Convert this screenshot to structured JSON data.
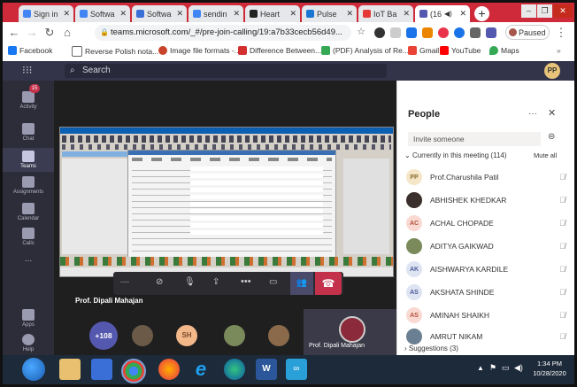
{
  "browser": {
    "tabs": [
      {
        "label": "Sign in",
        "color": "#4285f4"
      },
      {
        "label": "Softwa",
        "color": "#4285f4"
      },
      {
        "label": "Softwa",
        "color": "#3a6fd8"
      },
      {
        "label": "sendin",
        "color": "#4285f4"
      },
      {
        "label": "Heart",
        "color": "#222222"
      },
      {
        "label": "Pulse",
        "color": "#1976d2"
      },
      {
        "label": "IoT Ba",
        "color": "#e53935"
      },
      {
        "label": "(16",
        "color": "#5558af"
      }
    ],
    "new_tab": "+",
    "url": "teams.microsoft.com/_#/pre-join-calling/19:a7b33cecb56d49...",
    "paused_label": "Paused",
    "bookmarks": [
      "Facebook",
      "Reverse Polish nota...",
      "Image file formats -...",
      "Difference Between...",
      "(PDF) Analysis of Re...",
      "Gmail",
      "YouTube",
      "Maps"
    ],
    "bookmark_colors": [
      "#1877f2",
      "#0e4f8a",
      "#c7442a",
      "#d32f2f",
      "#34a853",
      "#ea4335",
      "#ff0000",
      "#34a853"
    ]
  },
  "teams": {
    "search_placeholder": "Search",
    "user_initials": "PP",
    "activity_badge": "15",
    "rail": [
      "Activity",
      "Chat",
      "Teams",
      "Assignments",
      "Calendar",
      "Calls",
      "...",
      "Apps",
      "Help"
    ]
  },
  "meeting": {
    "presenter": "Prof. Dipali Mahajan",
    "more_count": "+108",
    "tile_initials": "SH",
    "self_name": "Prof. Dipali Mahajan"
  },
  "people": {
    "title": "People",
    "invite_placeholder": "Invite someone",
    "section_label": "Currently in this meeting (114)",
    "mute_all": "Mute all",
    "participants": [
      {
        "initials": "PP",
        "name": "Prof.Charushila Patil",
        "bg": "#f5e6c8",
        "fg": "#8a6d2e"
      },
      {
        "initials": "",
        "name": "ABHISHEK KHEDKAR",
        "bg": "#3a2f2a",
        "fg": "#ffffff"
      },
      {
        "initials": "AC",
        "name": "ACHAL CHOPADE",
        "bg": "#f9d9d2",
        "fg": "#b5523e"
      },
      {
        "initials": "",
        "name": "ADITYA GAIKWAD",
        "bg": "#7a8a5a",
        "fg": "#ffffff"
      },
      {
        "initials": "AK",
        "name": "AISHWARYA KARDILE",
        "bg": "#dfe4f3",
        "fg": "#4a5a9a"
      },
      {
        "initials": "AS",
        "name": "AKSHATA SHINDE",
        "bg": "#dfe4f3",
        "fg": "#4a5a9a"
      },
      {
        "initials": "AS",
        "name": "AMINAH SHAIKH",
        "bg": "#f9d9d2",
        "fg": "#b5523e"
      },
      {
        "initials": "",
        "name": "AMRUT NIKAM",
        "bg": "#6b7f92",
        "fg": "#ffffff"
      }
    ],
    "suggestions": "Suggestions (3)"
  },
  "taskbar": {
    "time": "1:34 PM",
    "date": "10/28/2020"
  },
  "colors": {
    "teams_purple": "#5558af",
    "rail_bg": "#2d2d3a",
    "leave_red": "#c4314b",
    "chrome_red": "#cf2a3a"
  }
}
